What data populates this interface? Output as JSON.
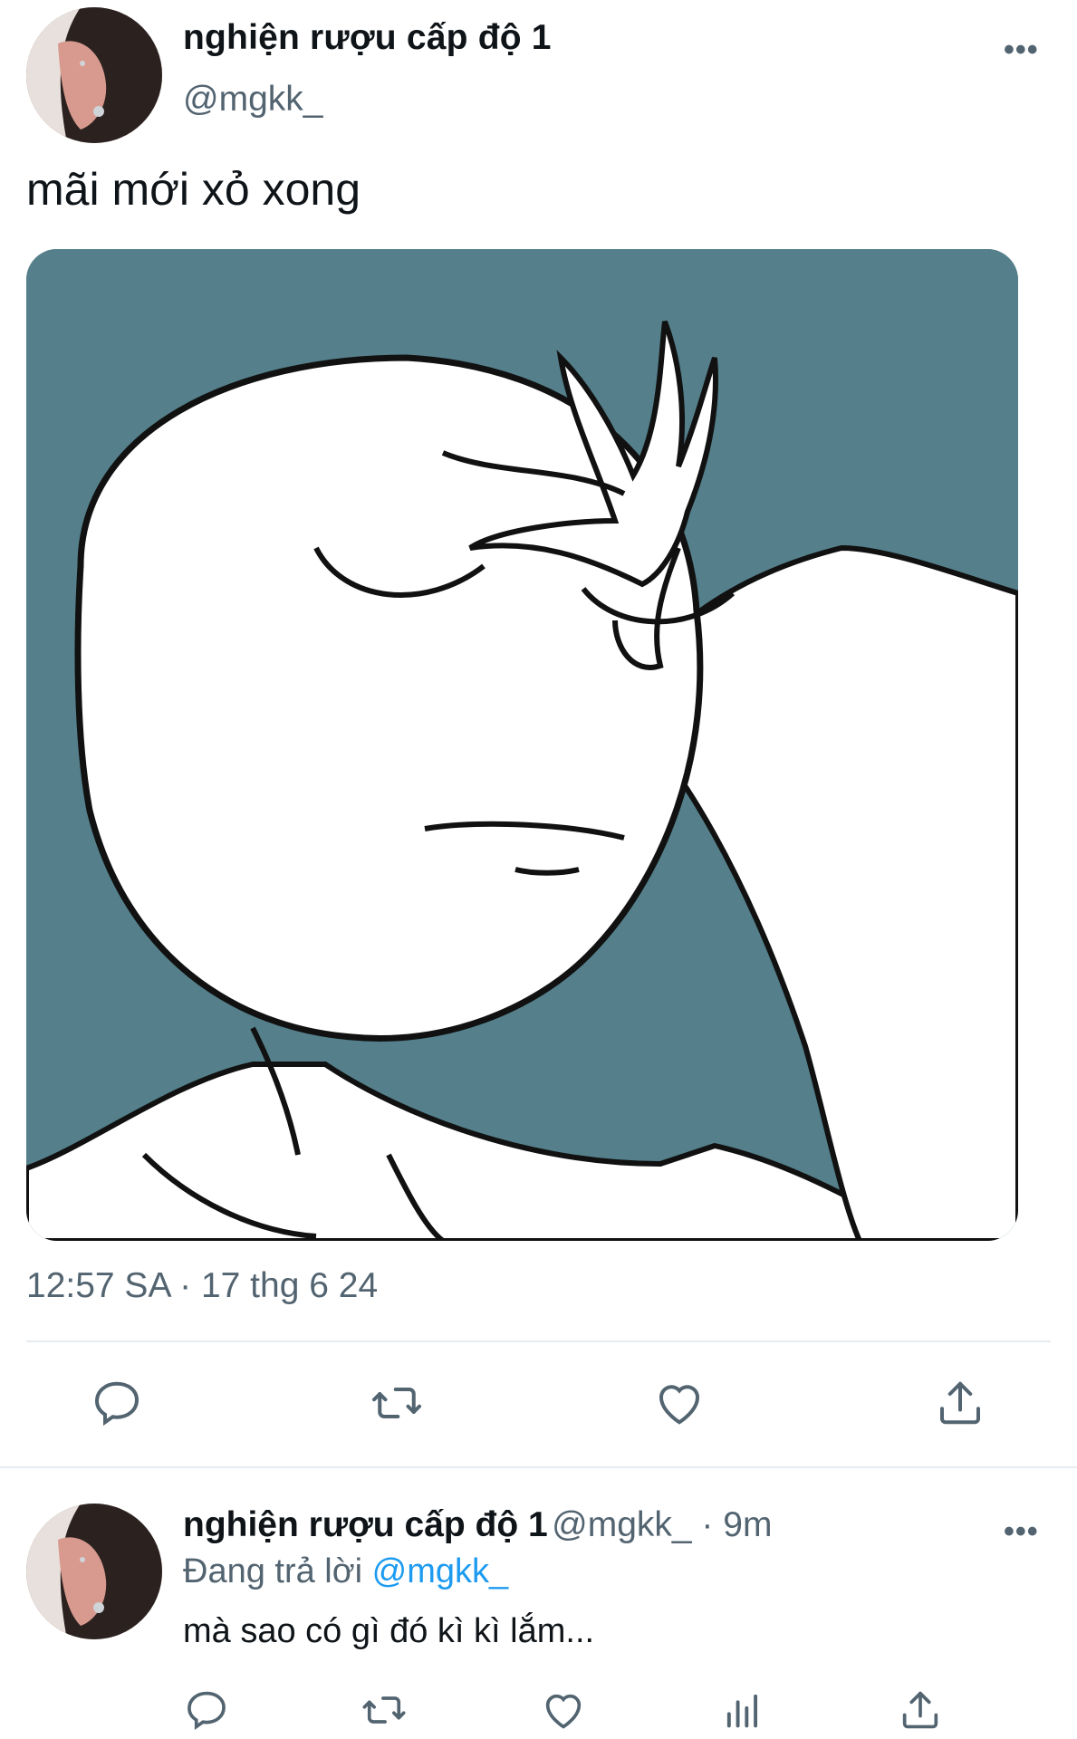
{
  "main_tweet": {
    "display_name": "nghiện rượu cấp độ 1",
    "handle": "@mgkk_",
    "more_label": "•••",
    "text": "mãi mới xỏ xong",
    "timestamp": "12:57 SA · 17 thg 6 24",
    "actions": [
      "reply-icon",
      "retweet-icon",
      "like-icon",
      "share-icon"
    ]
  },
  "reply_tweet": {
    "display_name": "nghiện rượu cấp độ 1",
    "handle": "@mgkk_",
    "separator": " · ",
    "time_ago": "9m",
    "more_label": "•••",
    "replying_prefix": "Đang trả lời",
    "replying_to": "@mgkk_",
    "text": "mà sao có gì đó kì kì lắm...",
    "actions": [
      "reply-icon",
      "retweet-icon",
      "like-icon",
      "analytics-icon",
      "share-icon"
    ]
  },
  "colors": {
    "text": "#0f1419",
    "secondary": "#536471",
    "link": "#1d9bf0",
    "media_bg": "#55808b",
    "divider": "#e6ecf0"
  }
}
